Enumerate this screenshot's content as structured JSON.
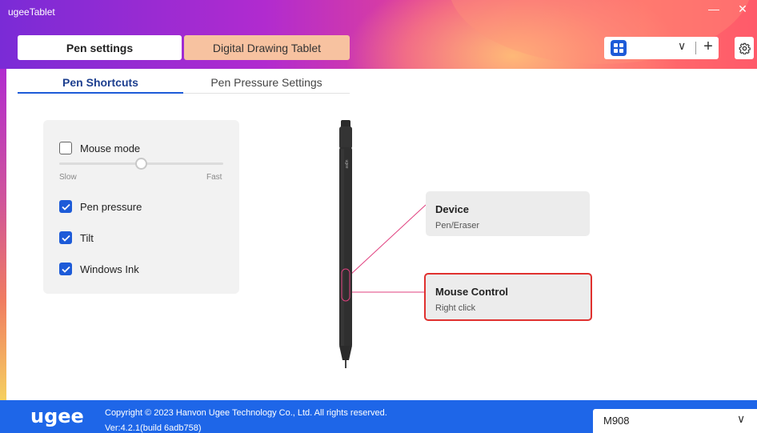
{
  "window": {
    "title": "ugeeTablet",
    "minimize_glyph": "—",
    "close_glyph": "✕"
  },
  "top_tabs": [
    {
      "label": "Pen settings",
      "active": true
    },
    {
      "label": "Digital Drawing Tablet",
      "active": false
    }
  ],
  "app_selector": {
    "icon": "windows-apps-icon",
    "chevron": "∨",
    "plus": "+"
  },
  "settings": {
    "icon": "gear-icon"
  },
  "sub_tabs": [
    {
      "label": "Pen Shortcuts",
      "active": true
    },
    {
      "label": "Pen Pressure Settings",
      "active": false
    }
  ],
  "panel": {
    "mouse_mode": {
      "label": "Mouse mode",
      "checked": false
    },
    "slider": {
      "slow_label": "Slow",
      "fast_label": "Fast",
      "value": 0.5
    },
    "pen_pressure": {
      "label": "Pen pressure",
      "checked": true
    },
    "tilt": {
      "label": "Tilt",
      "checked": true
    },
    "windows_ink": {
      "label": "Windows Ink",
      "checked": true
    }
  },
  "pen": {
    "brand_text": "ugee"
  },
  "callouts": {
    "device": {
      "title": "Device",
      "value": "Pen/Eraser"
    },
    "mouse_control": {
      "title": "Mouse Control",
      "value": "Right click"
    }
  },
  "colors": {
    "accent": "#1d5bd8",
    "footer": "#1e66e8",
    "highlight_border": "#e0312f",
    "leader_line": "#e0407f"
  },
  "footer": {
    "logo": "ugee",
    "copyright": "Copyright © 2023 Hanvon Ugee Technology Co., Ltd. All rights reserved.",
    "version": "Ver:4.2.1(build 6adb758)"
  },
  "device_select": {
    "value": "M908",
    "chevron": "∨"
  }
}
